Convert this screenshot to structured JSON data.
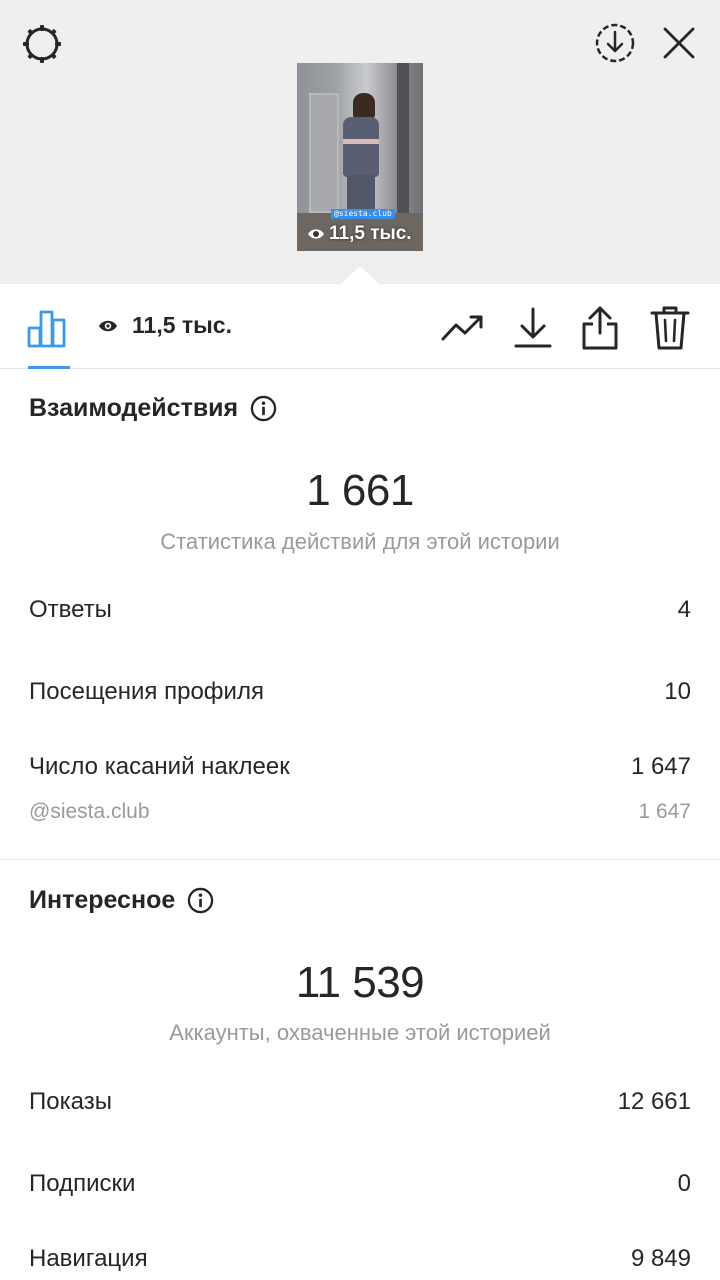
{
  "preview": {
    "sticker_tag": "@siesta.club",
    "views_overlay": "11,5 тыс.",
    "icons": {
      "settings": "gear-icon",
      "download_circle": "download-circle-icon",
      "close": "close-icon",
      "eye": "eye-icon"
    }
  },
  "toolbar": {
    "views": "11,5 тыс.",
    "icons": [
      "bar-chart-icon",
      "eye-icon",
      "trending-icon",
      "download-icon",
      "share-icon",
      "trash-icon"
    ],
    "accent_color": "#3b9ae8"
  },
  "interactions": {
    "title": "Взаимодействия",
    "total": "1 661",
    "caption": "Статистика действий для этой истории",
    "rows": [
      {
        "label": "Ответы",
        "value": "4"
      },
      {
        "label": "Посещения профиля",
        "value": "10"
      },
      {
        "label": "Число касаний наклеек",
        "value": "1 647"
      }
    ],
    "sub_rows": [
      {
        "label": "@siesta.club",
        "value": "1 647"
      }
    ]
  },
  "discovery": {
    "title": "Интересное",
    "total": "11 539",
    "caption": "Аккаунты, охваченные этой историей",
    "rows": [
      {
        "label": "Показы",
        "value": "12 661"
      },
      {
        "label": "Подписки",
        "value": "0"
      },
      {
        "label": "Навигация",
        "value": "9 849"
      }
    ]
  }
}
